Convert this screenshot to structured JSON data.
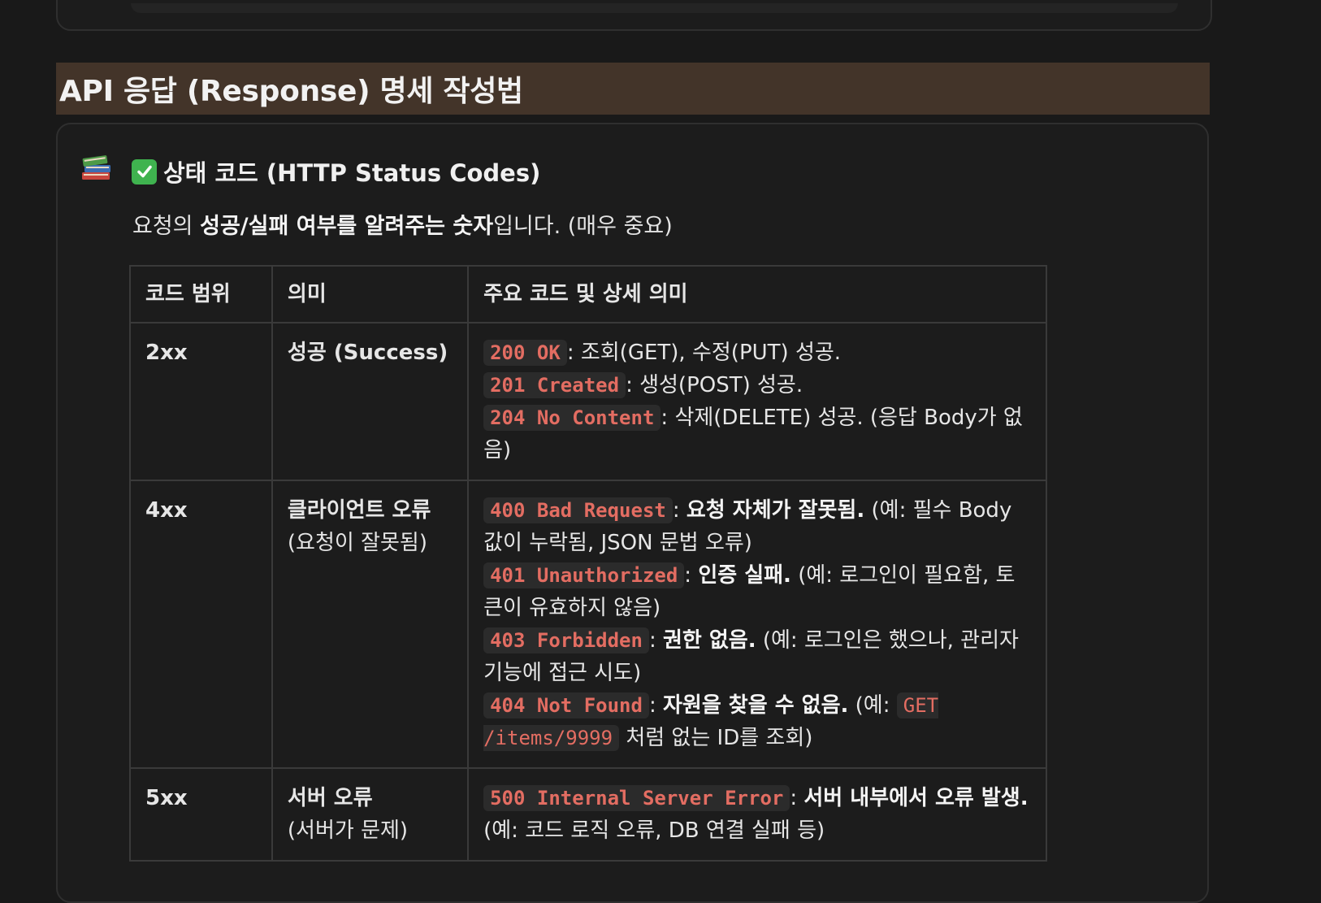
{
  "heading": "API 응답 (Response) 명세 작성법",
  "callout": {
    "icon": "books-icon",
    "title": "상태 코드 (HTTP Status Codes)",
    "desc_pre": "요청의 ",
    "desc_bold": "성공/실패 여부를 알려주는 숫자",
    "desc_post": "입니다. (매우 중요)"
  },
  "table": {
    "headers": [
      "코드 범위",
      "의미",
      "주요 코드 및 상세 의미"
    ],
    "rows": [
      {
        "range": "2xx",
        "meaning": "성공 (Success)",
        "meaning_sub": "",
        "codes": [
          {
            "code": "200 OK",
            "sep": ": ",
            "bold": "",
            "text": "조회(GET), 수정(PUT) 성공."
          },
          {
            "code": "201 Created",
            "sep": ": ",
            "bold": "",
            "text": "생성(POST) 성공."
          },
          {
            "code": "204 No Content",
            "sep": ": ",
            "bold": "",
            "text": "삭제(DELETE) 성공. (응답 Body가 없음)"
          }
        ]
      },
      {
        "range": "4xx",
        "meaning": "클라이언트 오류",
        "meaning_sub": "(요청이 잘못됨)",
        "codes": [
          {
            "code": "400 Bad Request",
            "sep": ": ",
            "bold": "요청 자체가 잘못됨.",
            "text": " (예: 필수 Body 값이 누락됨, JSON 문법 오류)"
          },
          {
            "code": "401 Unauthorized",
            "sep": ": ",
            "bold": "인증 실패.",
            "text": " (예: 로그인이 필요함, 토큰이 유효하지 않음)"
          },
          {
            "code": "403 Forbidden",
            "sep": ": ",
            "bold": "권한 없음.",
            "text": " (예: 로그인은 했으나, 관리자 기능에 접근 시도)"
          },
          {
            "code": "404 Not Found",
            "sep": ": ",
            "bold": "자원을 찾을 수 없음.",
            "text": " (예: ",
            "inline_code": "GET /items/9999",
            "tail": " 처럼 없는 ID를 조회)"
          }
        ]
      },
      {
        "range": "5xx",
        "meaning": "서버 오류",
        "meaning_sub": "(서버가 문제)",
        "codes": [
          {
            "code": "500 Internal Server Error",
            "sep": ": ",
            "bold": "서버 내부에서 오류 발생.",
            "text": " (예: 코드 로직 오류, DB 연결 실패 등)"
          }
        ]
      }
    ]
  }
}
